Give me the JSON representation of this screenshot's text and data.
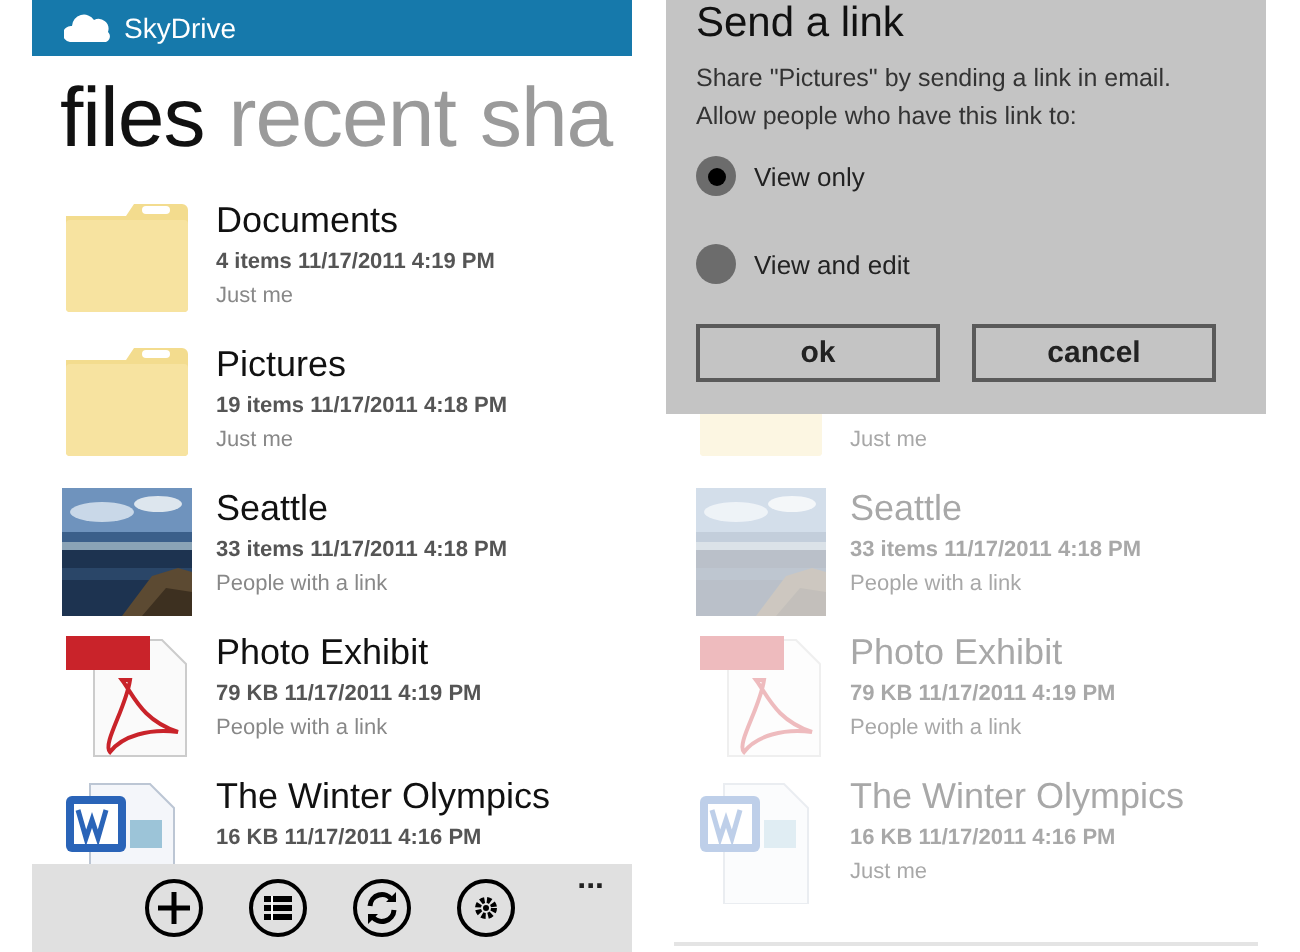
{
  "left_screen": {
    "header": {
      "title": "SkyDrive"
    },
    "pivot": [
      {
        "label": "files",
        "selected": true
      },
      {
        "label": "recent",
        "selected": false
      },
      {
        "label": "sha",
        "selected": false
      }
    ],
    "files": [
      {
        "kind": "folder",
        "name": "Documents",
        "details": "4 items  11/17/2011 4:19 PM",
        "sharing": "Just me"
      },
      {
        "kind": "folder",
        "name": "Pictures",
        "details": "19 items  11/17/2011 4:18 PM",
        "sharing": "Just me"
      },
      {
        "kind": "picture",
        "name": "Seattle",
        "details": "33 items  11/17/2011 4:18 PM",
        "sharing": "People with a link"
      },
      {
        "kind": "pdf",
        "name": "Photo Exhibit",
        "details": "79 KB  11/17/2011 4:19 PM",
        "sharing": "People with a link"
      },
      {
        "kind": "word",
        "name": "The Winter Olympics",
        "details": "16 KB  11/17/2011 4:16 PM"
      }
    ],
    "app_bar": {
      "buttons": [
        {
          "kind": "add"
        },
        {
          "kind": "list"
        },
        {
          "kind": "sync"
        },
        {
          "kind": "settings"
        }
      ],
      "more": "..."
    }
  },
  "right_screen": {
    "dialog": {
      "title": "Send a link",
      "message": [
        "Share \"Pictures\" by sending a link in email.",
        "Allow people who have this link to:"
      ],
      "options": [
        {
          "label": "View only",
          "selected": true
        },
        {
          "label": "View and edit",
          "selected": false
        }
      ],
      "buttons": [
        "ok",
        "cancel"
      ]
    },
    "files": [
      {
        "kind": "folder",
        "sharing": "Just me"
      },
      {
        "kind": "picture",
        "name": "Seattle",
        "details": "33 items  11/17/2011 4:18 PM",
        "sharing": "People with a link"
      },
      {
        "kind": "pdf",
        "name": "Photo Exhibit",
        "details": "79 KB  11/17/2011 4:19 PM",
        "sharing": "People with a link"
      },
      {
        "kind": "word",
        "name": "The Winter Olympics",
        "details": "16 KB  11/17/2011 4:16 PM",
        "sharing": "Just me"
      }
    ]
  }
}
